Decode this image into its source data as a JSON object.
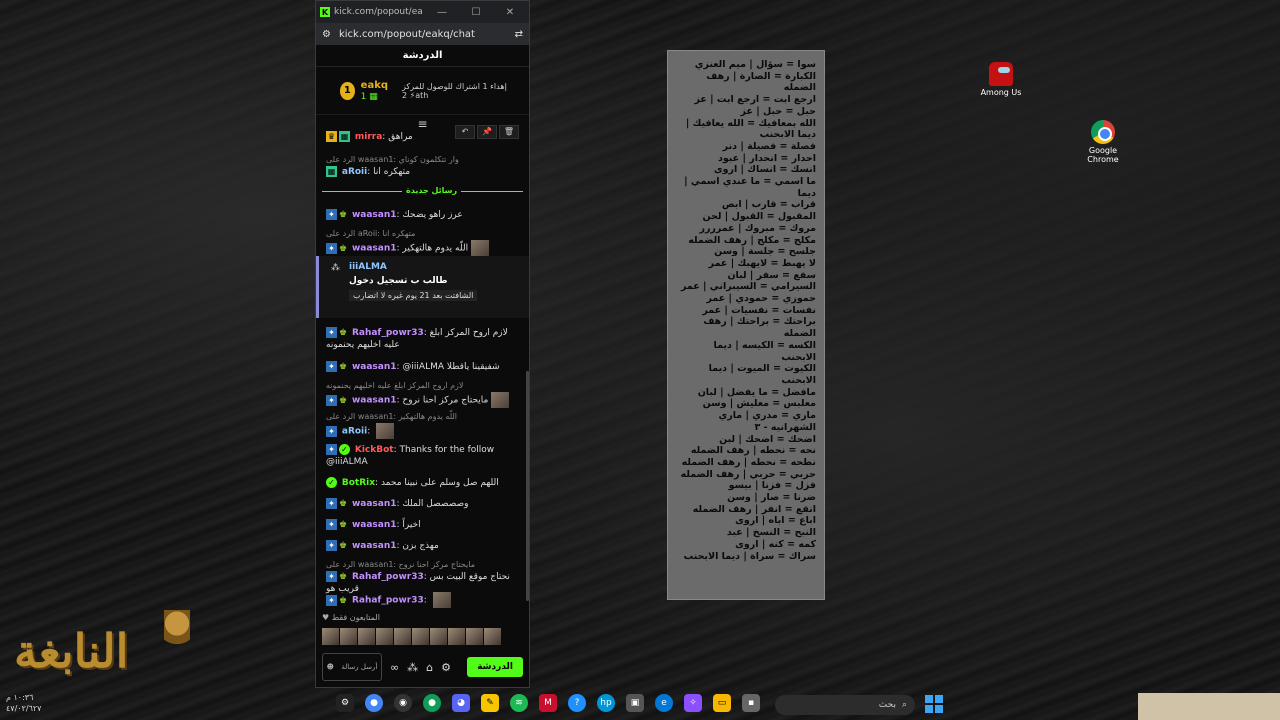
{
  "browser": {
    "tab_title": "kick.com/popout/eakq/chat...",
    "url": "kick.com/popout/eakq/chat",
    "chat_title": "الدردشة"
  },
  "pinned": {
    "gift_number": "1",
    "user": "eakq",
    "count": "1",
    "text": "إهداء 1 اشتراك للوصول للمركز 2 ⚡ath"
  },
  "messages": [
    {
      "user": "mirra",
      "text": "مراهق",
      "color": "#ff5a5a"
    },
    {
      "reply": "الرد على waasan1: وار تتكلمون كوناي"
    },
    {
      "user": "aRoii",
      "text": "متهكره انا",
      "color": "#8fc7ff"
    },
    {
      "divider": "رسائل جديدة"
    },
    {
      "user": "waasan1",
      "text": "عرز راهو يضحك",
      "color": "#c38fff"
    },
    {
      "reply": "الرد على aRoii: متهكره انا"
    },
    {
      "user": "waasan1",
      "text": "اللّه يدوم هالتهكير",
      "color": "#c38fff"
    },
    {
      "user": "Rahaf_powr33",
      "text": "لازم اروح المركز ابلغ عليه اخليهم يحنمونه",
      "color": "#c38fff"
    },
    {
      "user": "waasan1",
      "text": "@iiiALMA شفيقينا ياقطلا",
      "color": "#c38fff"
    },
    {
      "reply": "لازم اروح المركز ابلغ عليه اخليهم يحنمونه"
    },
    {
      "user": "waasan1",
      "text": "مايحتاج مركز احنا نروح",
      "color": "#c38fff"
    },
    {
      "reply": "الرد على waasan1: اللّه يدوم هالتهكير"
    },
    {
      "user": "aRoii",
      "text": "",
      "color": "#8fc7ff"
    },
    {
      "user": "KickBot",
      "text": "Thanks for the follow @iiiALMA",
      "color": "#ff5a5a"
    },
    {
      "user": "BotRix",
      "text": "اللهم صل وسلم على نبينا محمد",
      "color": "#53fc18"
    },
    {
      "user": "waasan1",
      "text": "وصصصصل الملك",
      "color": "#c38fff"
    },
    {
      "user": "waasan1",
      "text": "اخيراً",
      "color": "#c38fff"
    },
    {
      "user": "waasan1",
      "text": "مهذج بزن",
      "color": "#c38fff"
    },
    {
      "reply": "الرد على waasan1: مايحتاج مركز احنا نروح"
    },
    {
      "user": "Rahaf_powr33",
      "text": "نحتاج موقع البيت بس قريب هو",
      "color": "#c38fff"
    },
    {
      "user": "Rahaf_powr33",
      "text": "",
      "color": "#c38fff"
    }
  ],
  "system_card": {
    "user": "iiiALMA",
    "action": "طالب ب تسجيل دخول",
    "pill": "الشافتت بعد 21 يوم غيره لا اتضارب"
  },
  "viewers_label": "المتابعون فقط",
  "footer": {
    "input_placeholder": "أرسل رسالة",
    "chat_button": "الدردشة"
  },
  "notes": [
    "سوا = سؤال | ميم العنزي",
    "الكبارة = الصارة | رهف الضمله",
    "ارجع ابت = ارجع ابت | عز",
    "حبل = حبل | عز",
    "الله بمعافيك = الله يعافيك | ديما الابحنب",
    "فصلة = فصيلة | دنر",
    "احدار = انحدار | عبود",
    "انسك = انساك | اروى",
    "ما اسمي = ما عندي اسمي | ديما",
    "قراب = قارب | ابص",
    "المقبول = القبول | لحن",
    "مروك = مبروك | عمرررر",
    "مكلج = مكلج | رهف الضمله",
    "جلسح = جلسة | وسن",
    "لا يهبط = لايهبك | عمر",
    "سفع = سفر | لبان",
    "السيرامي = السيبراني | عمر",
    "حموزي = حمودي | عمر",
    "نفسات = نفسيات | عمر",
    "براحتك = براحتك | رهف الضمله",
    "الكسه = الكيسه | ديما الابحنب",
    "الكيوت = الميوت | ديما الابحنب",
    "مافضل = ما يفضل | لبان",
    "معلبس = معليش | وسن",
    "ماري = مدري | ماري الشهرانيه - ٣",
    "اضحك = اضحك | لبن",
    "نحه = نحطه | رهف الضمله",
    "نطحه = نحطه | رهف الضمله",
    "حربي = حربي | رهف الضمله",
    "فزل = فزنا | بيسو",
    "ضرنا = صار | وسن",
    "انقع = انفر | رهف الضمله",
    "اباع = اباه | اروى",
    "النبح = النسخ | عبد",
    "كمه = كنه | اروى",
    "سراك = سراة | ديما الابحنب"
  ],
  "desktop": {
    "among_us": "Among Us",
    "chrome": "Google Chrome"
  },
  "logo_text": "النابغة",
  "taskbar": {
    "time": "١٠:٣٦ م",
    "date": "٤٧/٠٢/٦٢٧",
    "search": "بحث"
  }
}
